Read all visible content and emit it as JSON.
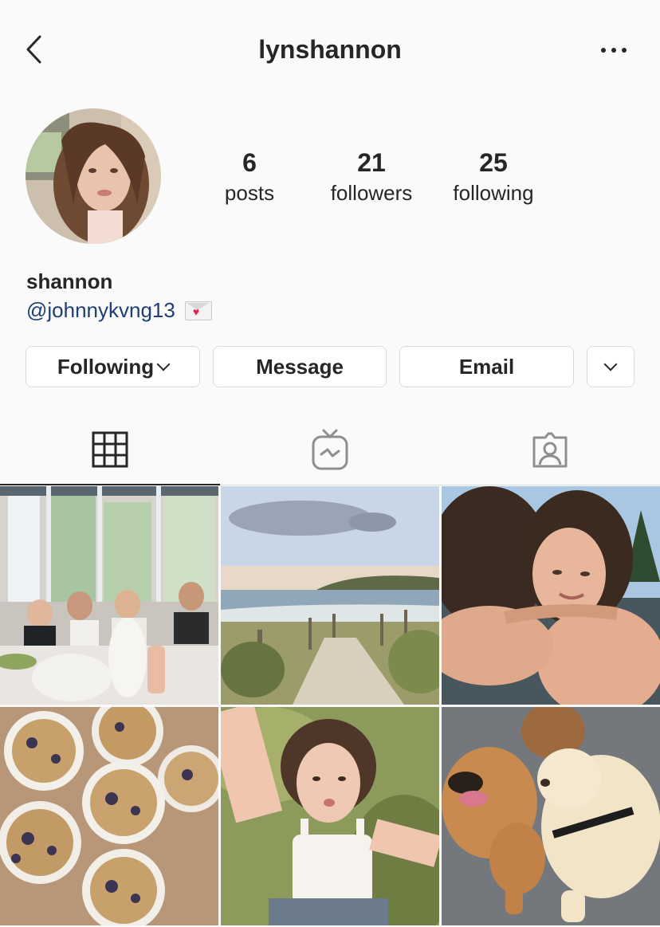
{
  "header": {
    "username": "lynshannon",
    "back_icon": "chevron-left-icon",
    "more_icon": "more-horizontal-icon"
  },
  "profile": {
    "stats": [
      {
        "value": "6",
        "label": "posts"
      },
      {
        "value": "21",
        "label": "followers"
      },
      {
        "value": "25",
        "label": "following"
      }
    ],
    "display_name": "shannon",
    "bio_handle": "@johnnykvng13",
    "bio_emoji": "love-letter-emoji"
  },
  "actions": {
    "following": "Following",
    "message": "Message",
    "email": "Email",
    "more_icon": "chevron-down-icon"
  },
  "tabs": [
    {
      "name": "grid",
      "icon": "grid-icon",
      "active": true
    },
    {
      "name": "igtv",
      "icon": "igtv-icon",
      "active": false
    },
    {
      "name": "tagged",
      "icon": "tagged-person-icon",
      "active": false
    }
  ],
  "posts": [
    {
      "subject": "friends-on-couch"
    },
    {
      "subject": "beach-path"
    },
    {
      "subject": "hug-selfie"
    },
    {
      "subject": "blueberry-muffins"
    },
    {
      "subject": "selfie-on-grass"
    },
    {
      "subject": "two-puppies"
    }
  ],
  "colors": {
    "text": "#262626",
    "link": "#1e3f73",
    "border": "#dbdbdb",
    "background": "#fafafa"
  }
}
